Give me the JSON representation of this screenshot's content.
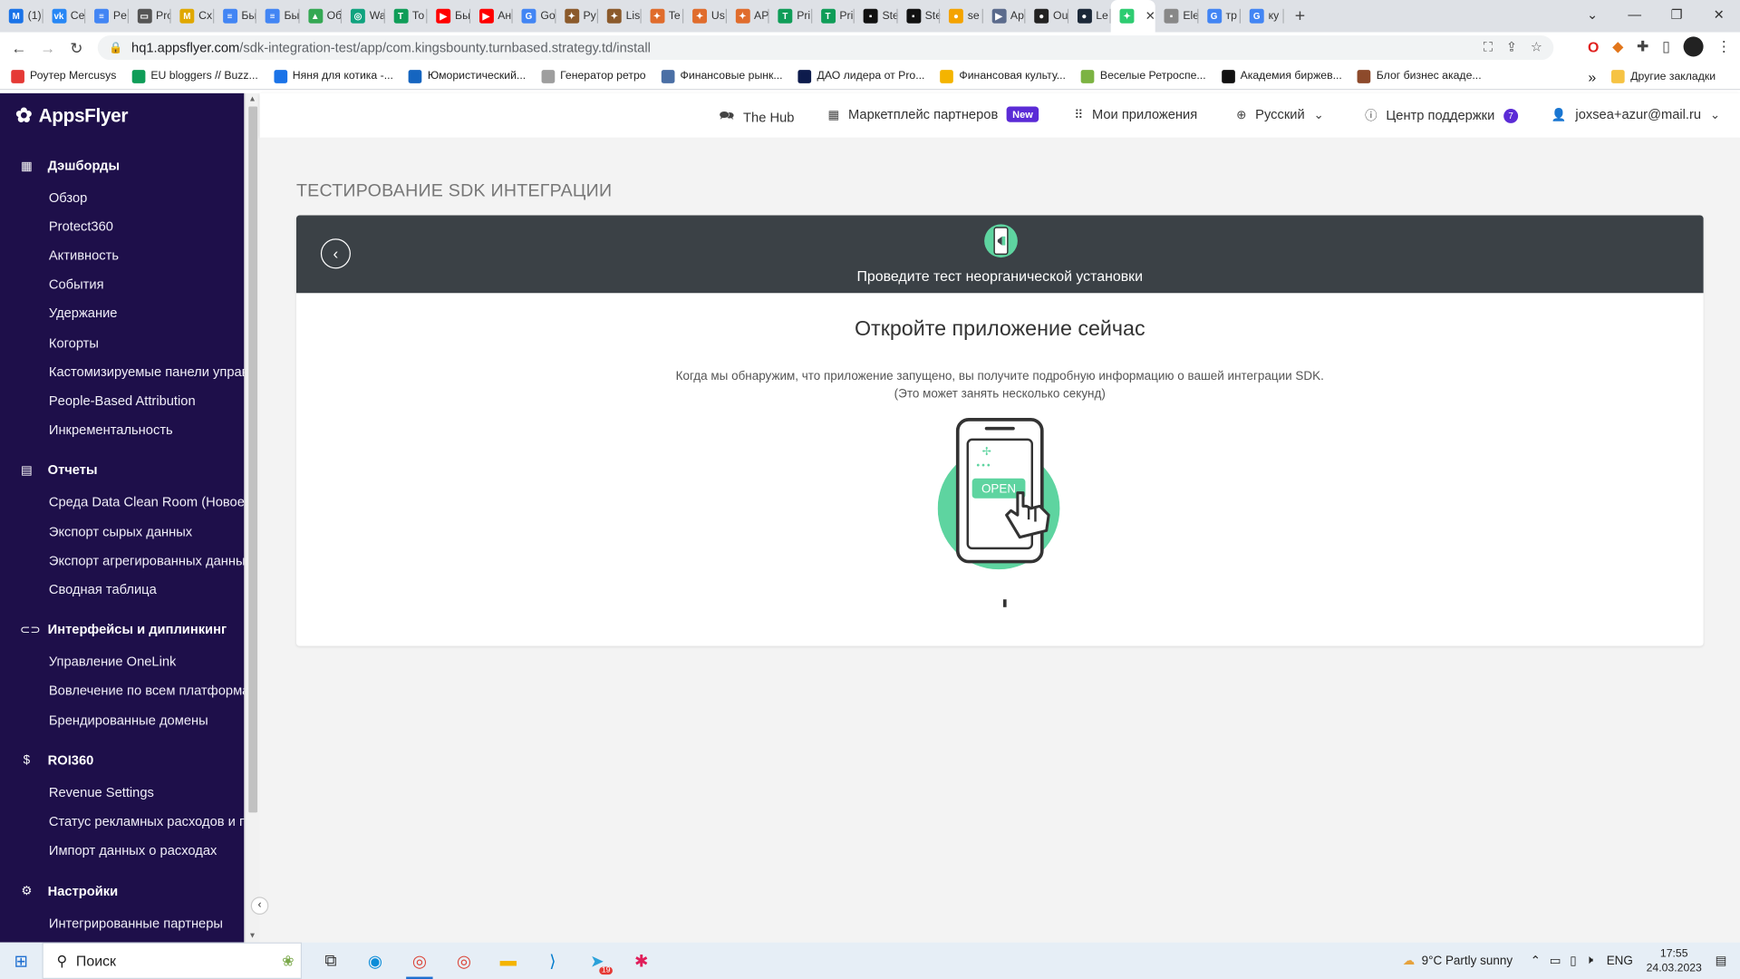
{
  "browser": {
    "tabs": [
      {
        "title": "(1)",
        "icon_color": "#1a73e8",
        "icon_glyph": "M"
      },
      {
        "title": "Ce",
        "icon_color": "#2787f5",
        "icon_glyph": "vk"
      },
      {
        "title": "Pe",
        "icon_color": "#4285f4",
        "icon_glyph": "≡"
      },
      {
        "title": "Pro",
        "icon_color": "#555555",
        "icon_glyph": "▭"
      },
      {
        "title": "Cx",
        "icon_color": "#e0a800",
        "icon_glyph": "M"
      },
      {
        "title": "Бы",
        "icon_color": "#4285f4",
        "icon_glyph": "≡"
      },
      {
        "title": "Бы",
        "icon_color": "#4285f4",
        "icon_glyph": "≡"
      },
      {
        "title": "Об",
        "icon_color": "#34a853",
        "icon_glyph": "▲"
      },
      {
        "title": "Wa",
        "icon_color": "#10a37f",
        "icon_glyph": "◎"
      },
      {
        "title": "То",
        "icon_color": "#0f9d58",
        "icon_glyph": "T"
      },
      {
        "title": "Бы",
        "icon_color": "#ff0000",
        "icon_glyph": "▶"
      },
      {
        "title": "Ан",
        "icon_color": "#ff0000",
        "icon_glyph": "▶"
      },
      {
        "title": "Go",
        "icon_color": "#4285f4",
        "icon_glyph": "G"
      },
      {
        "title": "Py",
        "icon_color": "#8b5a2b",
        "icon_glyph": "✦"
      },
      {
        "title": "Lis",
        "icon_color": "#8b5a2b",
        "icon_glyph": "✦"
      },
      {
        "title": "Te",
        "icon_color": "#e06c2c",
        "icon_glyph": "✦"
      },
      {
        "title": "Us",
        "icon_color": "#e06c2c",
        "icon_glyph": "✦"
      },
      {
        "title": "AP",
        "icon_color": "#e06c2c",
        "icon_glyph": "✦"
      },
      {
        "title": "Pri",
        "icon_color": "#0f9d58",
        "icon_glyph": "T"
      },
      {
        "title": "Pri",
        "icon_color": "#0f9d58",
        "icon_glyph": "T"
      },
      {
        "title": "Ste",
        "icon_color": "#111111",
        "icon_glyph": "▪"
      },
      {
        "title": "Ste",
        "icon_color": "#111111",
        "icon_glyph": "▪"
      },
      {
        "title": "se",
        "icon_color": "#f4a300",
        "icon_glyph": "●"
      },
      {
        "title": "Ap",
        "icon_color": "#5b6b8c",
        "icon_glyph": "▶"
      },
      {
        "title": "Ou",
        "icon_color": "#222222",
        "icon_glyph": "●"
      },
      {
        "title": "Le",
        "icon_color": "#1b2838",
        "icon_glyph": "●"
      },
      {
        "title": "",
        "icon_color": "#2ecc71",
        "icon_glyph": "✦",
        "active": true
      },
      {
        "title": "Ele",
        "icon_color": "#888888",
        "icon_glyph": "▪"
      },
      {
        "title": "тр",
        "icon_color": "#4285f4",
        "icon_glyph": "G"
      },
      {
        "title": "ку",
        "icon_color": "#4285f4",
        "icon_glyph": "G"
      }
    ],
    "url_host": "hq1.appsflyer.com",
    "url_path": "/sdk-integration-test/app/com.kingsbounty.turnbased.strategy.td/install",
    "bookmarks": [
      {
        "label": "Роутер Mercusys",
        "color": "#e53935"
      },
      {
        "label": "EU bloggers // Buzz...",
        "color": "#0f9d58"
      },
      {
        "label": "Няня для котика -...",
        "color": "#1a73e8"
      },
      {
        "label": "Юмористический...",
        "color": "#1565c0"
      },
      {
        "label": "Генератор ретро",
        "color": "#9e9e9e"
      },
      {
        "label": "Финансовые рынк...",
        "color": "#4a6fa5"
      },
      {
        "label": "ДАО лидера от Pro...",
        "color": "#0d1b4c"
      },
      {
        "label": "Финансовая культу...",
        "color": "#f4b400"
      },
      {
        "label": "Веселые Ретроспе...",
        "color": "#7cb342"
      },
      {
        "label": "Академия биржев...",
        "color": "#111111"
      },
      {
        "label": "Блог бизнес акаде...",
        "color": "#8d4a2b"
      }
    ],
    "bookmarks_more": "»",
    "other_bookmarks": "Другие закладки"
  },
  "sidebar": {
    "logo": "AppsFlyer",
    "sections": [
      {
        "label": "Дэшборды",
        "icon": "grid-icon",
        "glyph": "▦",
        "items": [
          "Обзор",
          "Protect360",
          "Активность",
          "События",
          "Удержание",
          "Когорты",
          "Кастомизируемые панели управ",
          "People-Based Attribution",
          "Инкрементальность"
        ]
      },
      {
        "label": "Отчеты",
        "icon": "report-icon",
        "glyph": "▤",
        "items": [
          "Среда Data Clean Room (Новое!)",
          "Экспорт сырых данных",
          "Экспорт агрегированных данных",
          "Сводная таблица"
        ]
      },
      {
        "label": "Интерфейсы и диплинкинг",
        "icon": "link-icon",
        "glyph": "⊂⊃",
        "items": [
          "Управление OneLink",
          "Вовлечение по всем платформа",
          "Брендированные домены"
        ]
      },
      {
        "label": "ROI360",
        "icon": "dollar-icon",
        "glyph": "$",
        "items": [
          "Revenue Settings",
          "Статус рекламных расходов и пр",
          "Импорт данных о расходах"
        ]
      },
      {
        "label": "Настройки",
        "icon": "gear-icon",
        "glyph": "⚙",
        "items": [
          "Интегрированные партнеры"
        ]
      }
    ]
  },
  "header": {
    "hub": "The Hub",
    "marketplace": "Маркетплейс партнеров",
    "marketplace_badge": "New",
    "my_apps": "Мои приложения",
    "language": "Русский",
    "support": "Центр поддержки",
    "support_count": "7",
    "user": "joxsea+azur@mail.ru"
  },
  "page": {
    "title": "ТЕСТИРОВАНИЕ SDK ИНТЕГРАЦИИ",
    "card_header": "Проведите тест неорганической установки",
    "heading": "Откройте приложение сейчас",
    "desc_line1": "Когда мы обнаружим, что приложение запущено, вы получите подробную информацию о вашей интеграции SDK.",
    "desc_line2": "(Это может занять несколько секунд)",
    "open_label": "OPEN"
  },
  "taskbar": {
    "search": "Поиск",
    "weather": "9°C  Partly sunny",
    "lang": "ENG",
    "time": "17:55",
    "date": "24.03.2023",
    "telegram_badge": "19"
  }
}
